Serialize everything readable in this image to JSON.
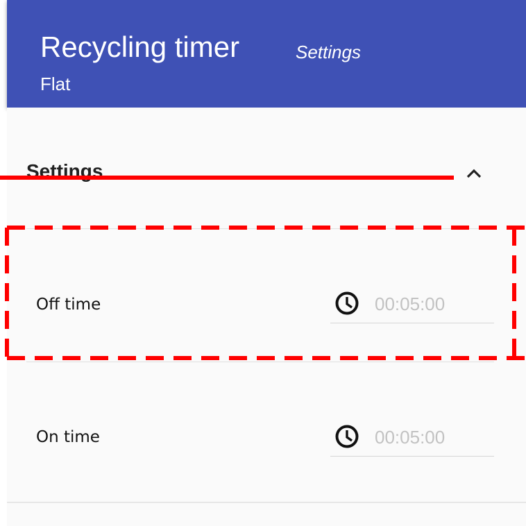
{
  "header": {
    "title": "Recycling timer",
    "subtitle": "Settings",
    "device": "Flat"
  },
  "section": {
    "title": "Settings",
    "expand_icon": "chevron-up-icon"
  },
  "rows": [
    {
      "label": "Off time",
      "value": "00:05:00",
      "icon": "clock-icon"
    },
    {
      "label": "On time",
      "value": "00:05:00",
      "icon": "clock-icon"
    }
  ],
  "colors": {
    "header_bg": "#3f51b5",
    "content_bg": "#fafafa",
    "annotation": "#ff0000",
    "value_text": "#c2c2c2"
  }
}
